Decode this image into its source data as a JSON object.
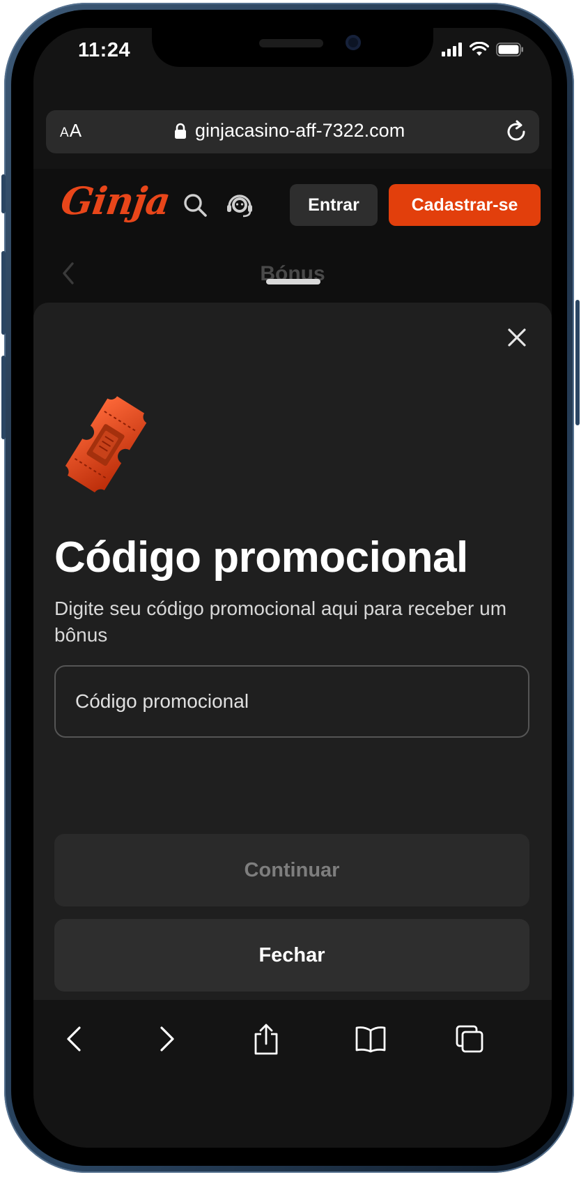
{
  "status_bar": {
    "time": "11:24",
    "icons": [
      "cellular-signal-icon",
      "wifi-icon",
      "battery-icon"
    ]
  },
  "browser": {
    "text_size_label_large": "A",
    "text_size_label_small": "A",
    "url": "ginjacasino-aff-7322.com",
    "icons": [
      "lock-icon",
      "reload-icon"
    ]
  },
  "site_header": {
    "logo_text": "Ginja",
    "login_label": "Entrar",
    "signup_label": "Cadastrar-se",
    "icons": [
      "search-icon",
      "support-headset-icon"
    ],
    "brand_color": "#e23f0c"
  },
  "page": {
    "title": "Bónus"
  },
  "promo_sheet": {
    "title": "Código promocional",
    "description": "Digite seu código promocional aqui para receber um bônus",
    "input_placeholder": "Código promocional",
    "input_value": "",
    "continue_label": "Continuar",
    "close_label": "Fechar",
    "icons": [
      "close-icon",
      "ticket-icon"
    ]
  },
  "bottom_toolbar": {
    "icons": [
      "back-icon",
      "forward-icon",
      "share-icon",
      "bookmarks-icon",
      "tabs-icon"
    ]
  }
}
